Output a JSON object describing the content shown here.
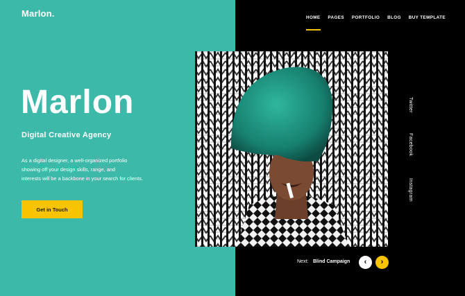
{
  "brand": {
    "logo": "Marlon."
  },
  "nav": {
    "items": [
      {
        "label": "HOME"
      },
      {
        "label": "PAGES"
      },
      {
        "label": "PORTFOLIO"
      },
      {
        "label": "BLOG"
      },
      {
        "label": "BUY TEMPLATE"
      }
    ],
    "active_index": 0
  },
  "hero": {
    "title": "Marlon",
    "subtitle": "Digital Creative Agency",
    "description_lines": [
      "As a digital designer, a well-organized portfolio",
      "showing off your design skills, range, and",
      "interests will be a backbone in your search for clients."
    ],
    "cta_label": "Get in Touch"
  },
  "social": {
    "twitter": "Twitter",
    "facebook": "Facebook",
    "instagram": "Instagram"
  },
  "pager": {
    "next_label": "Next:",
    "next_title": "Blind Campaign"
  },
  "icons": {
    "prev": "chevron-left-icon",
    "next": "chevron-right-icon"
  },
  "colors": {
    "teal": "#3cb9a8",
    "accent_yellow": "#f8c300",
    "dark": "#000000"
  }
}
